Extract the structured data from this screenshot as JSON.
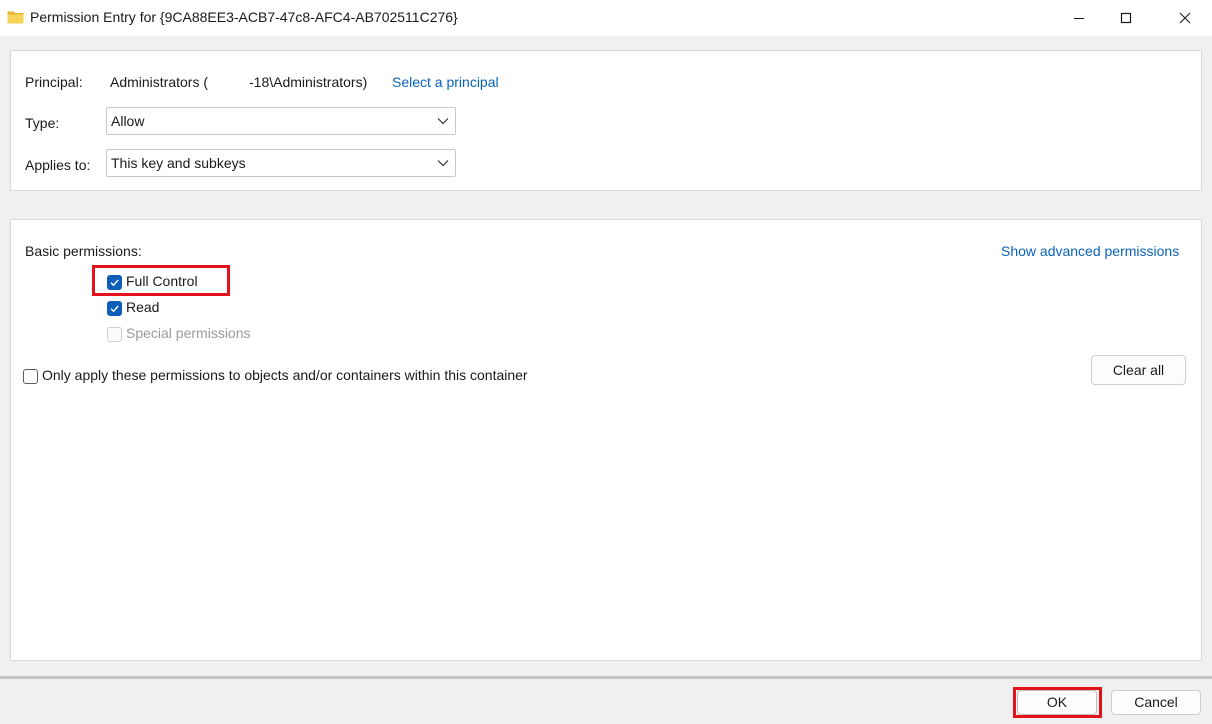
{
  "window": {
    "title": "Permission Entry for {9CA88EE3-ACB7-47c8-AFC4-AB702511C276}"
  },
  "principal": {
    "label": "Principal:",
    "value_prefix": "Administrators (",
    "value_suffix": "-18\\Administrators)",
    "select_link": "Select a principal"
  },
  "type": {
    "label": "Type:",
    "value": "Allow"
  },
  "applies_to": {
    "label": "Applies to:",
    "value": "This key and subkeys"
  },
  "permissions": {
    "heading": "Basic permissions:",
    "show_advanced_link": "Show advanced permissions",
    "items": [
      {
        "label": "Full Control",
        "checked": true,
        "disabled": false
      },
      {
        "label": "Read",
        "checked": true,
        "disabled": false
      },
      {
        "label": "Special permissions",
        "checked": false,
        "disabled": true
      }
    ],
    "only_apply_label": "Only apply these permissions to objects and/or containers within this container",
    "only_apply_checked": false,
    "clear_all_label": "Clear all"
  },
  "footer": {
    "ok_label": "OK",
    "cancel_label": "Cancel"
  },
  "colors": {
    "accent": "#0f5fb8",
    "link": "#0a63b9",
    "highlight": "#e3121b"
  }
}
